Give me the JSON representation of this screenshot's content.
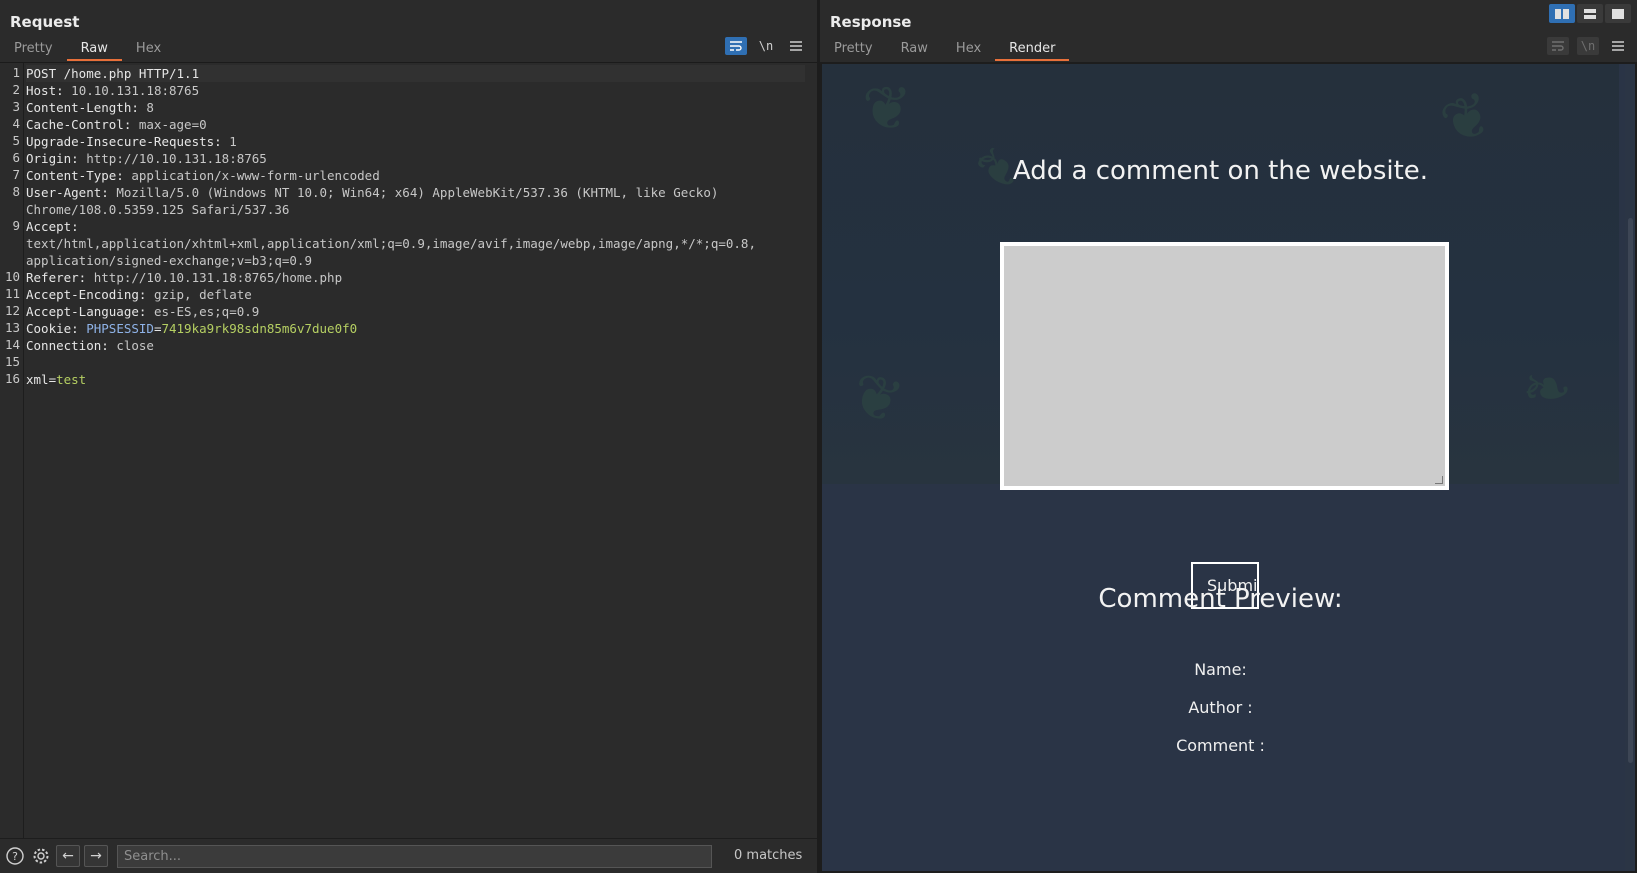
{
  "request": {
    "title": "Request",
    "tabs": [
      "Pretty",
      "Raw",
      "Hex"
    ],
    "active_tab": "Raw",
    "tool_icons": [
      "wrap-icon",
      "newline-icon",
      "menu-icon"
    ],
    "lines": [
      {
        "n": "1",
        "k": "POST /home.php HTTP/1.1",
        "v": ""
      },
      {
        "n": "2",
        "k": "Host:",
        "v": " 10.10.131.18:8765"
      },
      {
        "n": "3",
        "k": "Content-Length:",
        "v": " 8"
      },
      {
        "n": "4",
        "k": "Cache-Control:",
        "v": " max-age=0"
      },
      {
        "n": "5",
        "k": "Upgrade-Insecure-Requests:",
        "v": " 1"
      },
      {
        "n": "6",
        "k": "Origin:",
        "v": " http://10.10.131.18:8765"
      },
      {
        "n": "7",
        "k": "Content-Type:",
        "v": " application/x-www-form-urlencoded"
      },
      {
        "n": "8",
        "k": "User-Agent:",
        "v": " Mozilla/5.0 (Windows NT 10.0; Win64; x64) AppleWebKit/537.36 (KHTML, like Gecko)"
      },
      {
        "n": "",
        "k": "",
        "v": "Chrome/108.0.5359.125 Safari/537.36"
      },
      {
        "n": "9",
        "k": "Accept:",
        "v": ""
      },
      {
        "n": "",
        "k": "",
        "v": "text/html,application/xhtml+xml,application/xml;q=0.9,image/avif,image/webp,image/apng,*/*;q=0.8,"
      },
      {
        "n": "",
        "k": "",
        "v": "application/signed-exchange;v=b3;q=0.9"
      },
      {
        "n": "10",
        "k": "Referer:",
        "v": " http://10.10.131.18:8765/home.php"
      },
      {
        "n": "11",
        "k": "Accept-Encoding:",
        "v": " gzip, deflate"
      },
      {
        "n": "12",
        "k": "Accept-Language:",
        "v": " es-ES,es;q=0.9"
      },
      {
        "n": "13",
        "k": "Cookie:",
        "v": " "
      },
      {
        "n": "14",
        "k": "Connection:",
        "v": " close"
      },
      {
        "n": "15",
        "k": "",
        "v": ""
      },
      {
        "n": "16",
        "k": "",
        "v": ""
      }
    ],
    "cookie": {
      "name": "PHPSESSID",
      "eq": "=",
      "value": "7419ka9rk98sdn85m6v7due0f0"
    },
    "body": {
      "name": "xml",
      "eq": "=",
      "value": "test"
    },
    "search": {
      "placeholder": "Search...",
      "matches": "0 matches"
    }
  },
  "response": {
    "title": "Response",
    "tabs": [
      "Pretty",
      "Raw",
      "Hex",
      "Render"
    ],
    "active_tab": "Render",
    "render": {
      "heading": "Add a comment on the website.",
      "submit_label": "Submi",
      "preview_heading": "Comment Preview:",
      "name_label": "Name:",
      "author_label": "Author :",
      "comment_label": "Comment :"
    }
  },
  "colors": {
    "accent": "#e8703a",
    "active_icon": "#2f6fb3",
    "cookie_value": "#b5cf62"
  }
}
